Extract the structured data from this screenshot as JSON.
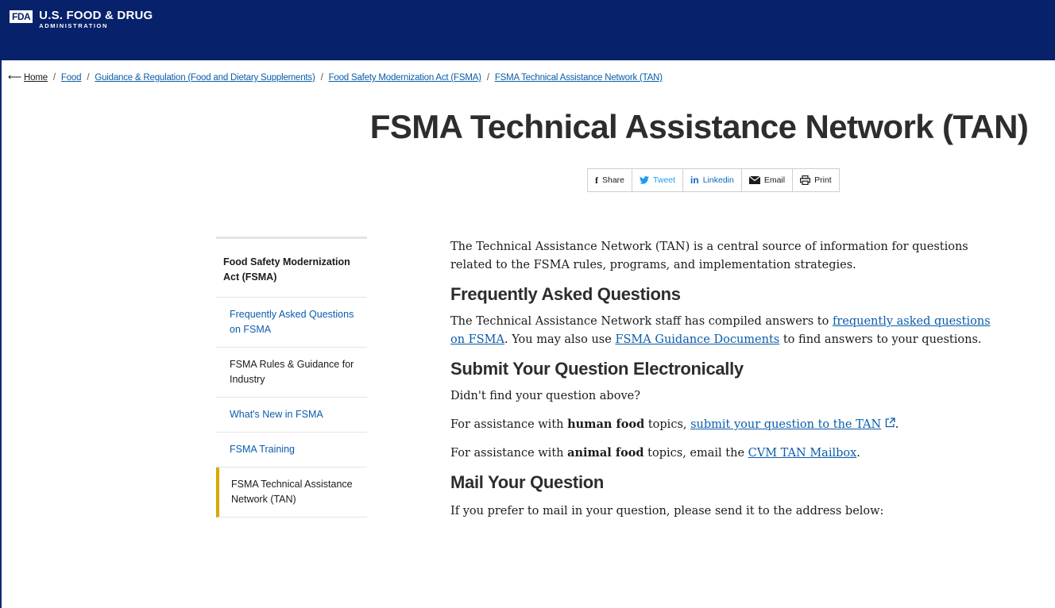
{
  "header": {
    "logo_mark": "FDA",
    "logo_line1": "U.S. FOOD & DRUG",
    "logo_line2": "ADMINISTRATION",
    "background": "#07216b"
  },
  "breadcrumb": {
    "back_icon": "back-arrow-icon",
    "home": "Home",
    "items": [
      "Food",
      "Guidance & Regulation (Food and Dietary Supplements)",
      "Food Safety Modernization Act (FSMA)",
      "FSMA Technical Assistance Network (TAN)"
    ],
    "separator": "/"
  },
  "page_title": "FSMA Technical Assistance Network (TAN)",
  "share": {
    "facebook": "Share",
    "twitter": "Tweet",
    "linkedin": "Linkedin",
    "email": "Email",
    "print": "Print"
  },
  "sidebar": {
    "heading": "Food Safety Modernization Act (FSMA)",
    "items": [
      {
        "label": "Frequently Asked Questions on FSMA",
        "style": "link"
      },
      {
        "label": "FSMA Rules & Guidance for Industry",
        "style": "plain"
      },
      {
        "label": "What's New in FSMA",
        "style": "link"
      },
      {
        "label": "FSMA Training",
        "style": "link"
      },
      {
        "label": "FSMA Technical Assistance Network (TAN)",
        "style": "active"
      }
    ],
    "active_color": "#d8a900"
  },
  "content": {
    "intro": "The Technical Assistance Network (TAN) is a central source of information for questions related to the FSMA rules, programs, and implementation strategies.",
    "faq_heading": "Frequently Asked Questions",
    "faq_text_1": "The Technical Assistance Network staff has compiled answers to ",
    "faq_link_1": "frequently asked questions on FSMA",
    "faq_text_2": ". You may also use ",
    "faq_link_2": "FSMA Guidance Documents",
    "faq_text_3": " to find answers to your questions.",
    "submit_heading": "Submit Your Question Electronically",
    "submit_p1": "Didn't find your question above?",
    "submit_p2_a": "For assistance with ",
    "submit_p2_bold": "human food",
    "submit_p2_b": " topics, ",
    "submit_p2_link": "submit your question to the TAN",
    "submit_p2_end": ".",
    "submit_p3_a": "For assistance with ",
    "submit_p3_bold": "animal food",
    "submit_p3_b": " topics, email the ",
    "submit_p3_link": "CVM TAN Mailbox",
    "submit_p3_end": ".",
    "mail_heading": "Mail Your Question",
    "mail_p1": "If you prefer to mail in your question, please send it to the address below:"
  }
}
